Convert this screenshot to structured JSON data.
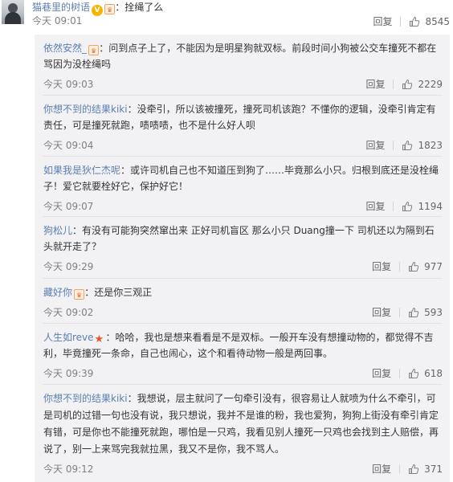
{
  "post": {
    "author": "猫巷里的树语",
    "text": "：拴绳了么",
    "time": "今天 09:01",
    "reply_label": "回复",
    "likes": "8545"
  },
  "colors": {
    "name": "#5b7fb0",
    "meta": "#808080",
    "panel": "#f2f2f5"
  },
  "replies": [
    {
      "user": "依然安然_",
      "badges": [
        "vip-icon"
      ],
      "text": "：问到点子上了，不能因为是明星狗就双标。前段时间小狗被公交车撞死不都在骂因为没栓绳吗",
      "time": "今天 09:03",
      "reply_label": "回复",
      "likes": "2229"
    },
    {
      "user": "你想不到的结果kiki",
      "badges": [],
      "text": "：没牵引，所以该被撞死，撞死司机该跑？不懂你的逻辑，没牵引肯定有责任，可是撞死就跑，啧啧啧，也不是什么好人呗",
      "time": "今天 09:04",
      "reply_label": "回复",
      "likes": "1823"
    },
    {
      "user": "如果我是狄仁杰呢",
      "badges": [],
      "text": "：或许司机自己也不知道压到狗了……毕竟那么小只。归根到底还是没栓绳子！爱它就要栓好它，保护好它！",
      "time": "今天 09:07",
      "reply_label": "回复",
      "likes": "1194"
    },
    {
      "user": "狗松儿",
      "badges": [],
      "text": "：有没有可能狗突然窜出来 正好司机盲区 那么小只 Duang撞一下 司机还以为隔到石头就开走了？",
      "time": "今天 09:29",
      "reply_label": "回复",
      "likes": "977"
    },
    {
      "user": "藏好你",
      "badges": [
        "vip-icon"
      ],
      "text": "：还是你三观正",
      "time": "今天 09:02",
      "reply_label": "回复",
      "likes": "593"
    },
    {
      "user": "人生如reve",
      "badges": [
        "star-icon"
      ],
      "text": "：哈哈，我也是想来看看是不是双标。一般开车没有想撞动物的，都觉得不吉利，毕竟撞死一条命，自己也闹心，这个和看待动物一般是两回事。",
      "time": "今天 09:39",
      "reply_label": "回复",
      "likes": "618"
    },
    {
      "user": "你想不到的结果kiki",
      "badges": [],
      "text": "：我想说，层主就问了一句牵引没有，很容易让人就喷为什么不牵引，可是司机的过错一句也没有说，我只想说，我并不是谁的粉，我也爱狗，狗狗上街没有牵引肯定有错，可是你也不能撞死就跑，哪怕是一只鸡，我看见别人撞死一只鸡也会找到主人赔偿，再说了，别一上来骂完我就拉黑，我又不是你，我不骂人。",
      "time": "今天 09:12",
      "reply_label": "回复",
      "likes": "371"
    }
  ]
}
